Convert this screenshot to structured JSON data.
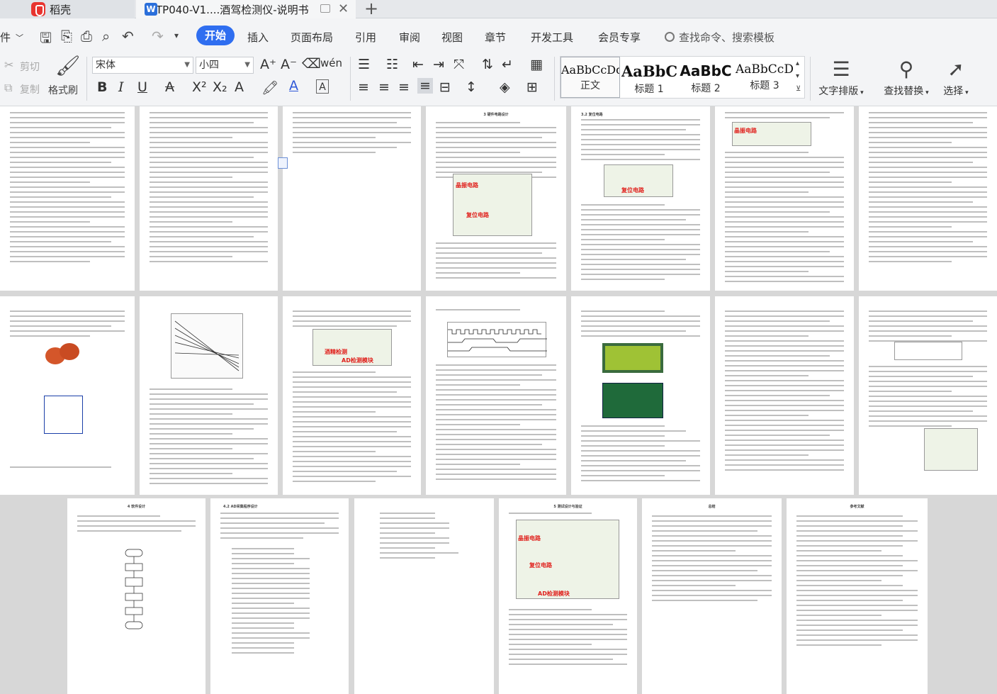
{
  "tabs": [
    {
      "label": "稻壳"
    },
    {
      "label": "TP040-V1....酒驾检测仪-说明书"
    }
  ],
  "menu": {
    "file": "件",
    "items": [
      "开始",
      "插入",
      "页面布局",
      "引用",
      "审阅",
      "视图",
      "章节",
      "开发工具",
      "会员专享"
    ],
    "search": "查找命令、搜索模板"
  },
  "toolbar": {
    "cut": "剪切",
    "copy": "复制",
    "format_painter": "格式刷",
    "font": "宋体",
    "size": "小四",
    "text_layout": "文字排版",
    "find_replace": "查找替换",
    "select": "选择"
  },
  "styles": [
    {
      "sample": "AaBbCcDd",
      "name": "正文"
    },
    {
      "sample": "AaBbC",
      "name": "标题 1"
    },
    {
      "sample": "AaBbC",
      "name": "标题 2"
    },
    {
      "sample": "AaBbCcD",
      "name": "标题 3"
    }
  ],
  "pages": {
    "p4_title": "3 硬件电路设计",
    "p5_title": "3.2 复位电路",
    "p10_label1": "酒精检测",
    "p10_label2": "AD检测模块",
    "p8_label": "晶振电路",
    "p5_label": "复位电路",
    "p4_label1": "晶振电路",
    "p4_label2": "复位电路",
    "p15_title": "4 软件设计",
    "p16_title": "4.2 AD采集程序设计",
    "p18_title": "5 测试设计与验证",
    "p18_label1": "晶振电路",
    "p18_label2": "复位电路",
    "p18_label3": "AD检测模块",
    "p19_title": "总结",
    "p20_title": "参考文献"
  }
}
